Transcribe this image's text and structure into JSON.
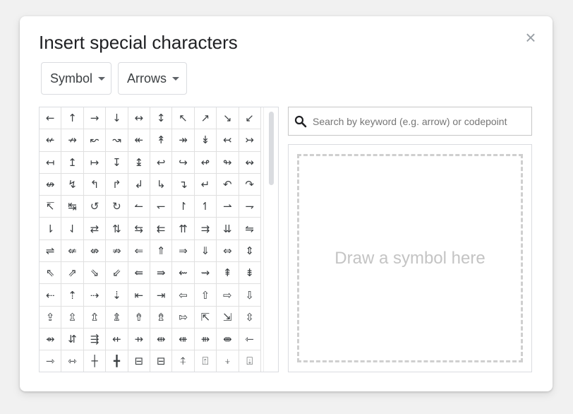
{
  "dialog": {
    "title": "Insert special characters",
    "close_glyph": "×"
  },
  "filters": {
    "category": "Symbol",
    "subcategory": "Arrows"
  },
  "search": {
    "placeholder": "Search by keyword (e.g. arrow) or codepoint",
    "value": ""
  },
  "draw_area": {
    "label": "Draw a symbol here"
  },
  "symbols": [
    "←",
    "↑",
    "→",
    "↓",
    "↔",
    "↕",
    "↖",
    "↗",
    "↘",
    "↙",
    "↚",
    "↛",
    "↜",
    "↝",
    "↞",
    "↟",
    "↠",
    "↡",
    "↢",
    "↣",
    "↤",
    "↥",
    "↦",
    "↧",
    "↨",
    "↩",
    "↪",
    "↫",
    "↬",
    "↭",
    "↮",
    "↯",
    "↰",
    "↱",
    "↲",
    "↳",
    "↴",
    "↵",
    "↶",
    "↷",
    "↸",
    "↹",
    "↺",
    "↻",
    "↼",
    "↽",
    "↾",
    "↿",
    "⇀",
    "⇁",
    "⇂",
    "⇃",
    "⇄",
    "⇅",
    "⇆",
    "⇇",
    "⇈",
    "⇉",
    "⇊",
    "⇋",
    "⇌",
    "⇍",
    "⇎",
    "⇏",
    "⇐",
    "⇑",
    "⇒",
    "⇓",
    "⇔",
    "⇕",
    "⇖",
    "⇗",
    "⇘",
    "⇙",
    "⇚",
    "⇛",
    "⇜",
    "⇝",
    "⇞",
    "⇟",
    "⇠",
    "⇡",
    "⇢",
    "⇣",
    "⇤",
    "⇥",
    "⇦",
    "⇧",
    "⇨",
    "⇩",
    "⇪",
    "⇫",
    "⇬",
    "⇭",
    "⇮",
    "⇯",
    "⇰",
    "⇱",
    "⇲",
    "⇳",
    "⇴",
    "⇵",
    "⇶",
    "⇷",
    "⇸",
    "⇹",
    "⇺",
    "⇻",
    "⇼",
    "⇽",
    "⇾",
    "⇿",
    "┼",
    "╋",
    "⊟",
    "⊟",
    "⍏",
    "⍐",
    "⍖",
    "⍗"
  ]
}
